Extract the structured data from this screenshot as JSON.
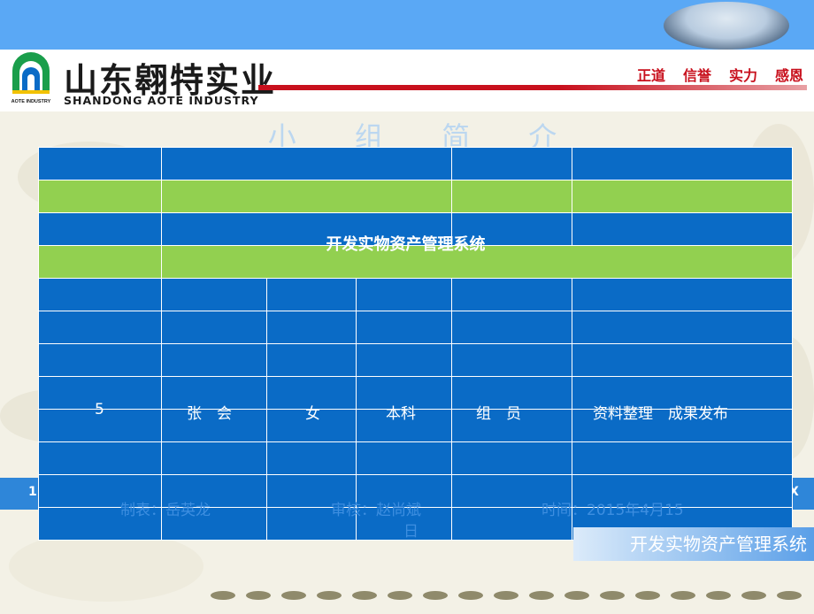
{
  "header": {
    "brand_cn": "山东翱特实业",
    "brand_en": "SHANDONG AOTE INDUSTRY",
    "logo_small_text": "AOTE INDUSTRY",
    "slogans": [
      "正道",
      "信誉",
      "实力",
      "感恩"
    ]
  },
  "section_title": "小 组 简 介",
  "table": {
    "overlay_title": "开发实物资产管理系统",
    "member_row": {
      "no": "5",
      "name": "张　会",
      "gender": "女",
      "education": "本科",
      "role": "组　员",
      "duty": "资料整理　成果发布"
    }
  },
  "band": {
    "left": "1",
    "right": "X"
  },
  "footer_meta": {
    "made_by": "制表：岳英龙",
    "reviewed_by": "审核：赵尚斌",
    "reviewed_by_cont": "日",
    "date": "时间：2015年4月15"
  },
  "footer_label": "开发实物资产管理系统",
  "colors": {
    "top_bar": "#5aa8f5",
    "table_blue": "#0a6bc6",
    "table_green": "#92d050",
    "accent_red": "#c8101d",
    "band_blue": "#2e86d9"
  }
}
